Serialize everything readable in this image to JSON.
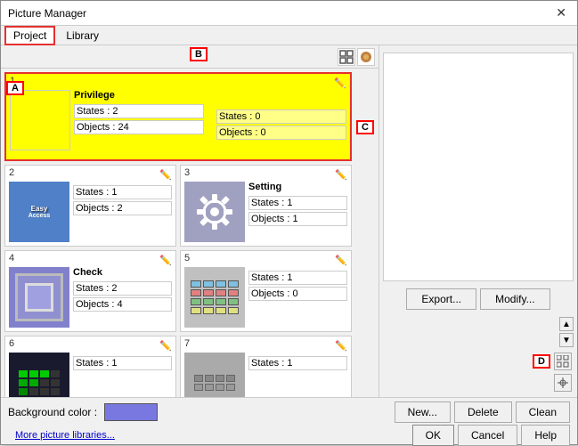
{
  "window": {
    "title": "Picture Manager",
    "close_label": "✕"
  },
  "menu": {
    "project_label": "Project",
    "library_label": "Library"
  },
  "toolbar": {
    "label_b": "B",
    "icon1": "⬜",
    "icon2": "🎨"
  },
  "annotations": {
    "a": "A",
    "b": "B",
    "c": "C",
    "d": "D"
  },
  "grid": {
    "cells": [
      {
        "number": "1",
        "name": "Privilege",
        "states": "States : 2",
        "objects": "Objects : 24",
        "selected": true,
        "thumb_type": "avatar",
        "states_inner": "States : 0",
        "objects_inner": "Objects : 0"
      },
      {
        "number": "2",
        "name": "",
        "states": "States : 1",
        "objects": "Objects : 2",
        "selected": false,
        "thumb_type": "easy-access"
      },
      {
        "number": "3",
        "name": "Setting",
        "states": "States : 1",
        "objects": "Objects : 1",
        "selected": false,
        "thumb_type": "gear"
      },
      {
        "number": "4",
        "name": "Check",
        "states": "States : 2",
        "objects": "Objects : 4",
        "selected": false,
        "thumb_type": "check"
      },
      {
        "number": "5",
        "name": "",
        "states": "States : 1",
        "objects": "Objects : 0",
        "selected": false,
        "thumb_type": "keypad"
      },
      {
        "number": "6",
        "name": "",
        "states": "States : 1",
        "objects": "",
        "selected": false,
        "thumb_type": "row6"
      },
      {
        "number": "7",
        "name": "",
        "states": "States : 1",
        "objects": "",
        "selected": false,
        "thumb_type": "row7"
      }
    ]
  },
  "right_panel": {
    "export_label": "Export...",
    "modify_label": "Modify..."
  },
  "bottom": {
    "bg_color_label": "Background color :",
    "new_label": "New...",
    "delete_label": "Delete",
    "clean_label": "Clean",
    "ok_label": "OK",
    "cancel_label": "Cancel",
    "help_label": "Help"
  },
  "footer": {
    "link_label": "More picture libraries..."
  }
}
